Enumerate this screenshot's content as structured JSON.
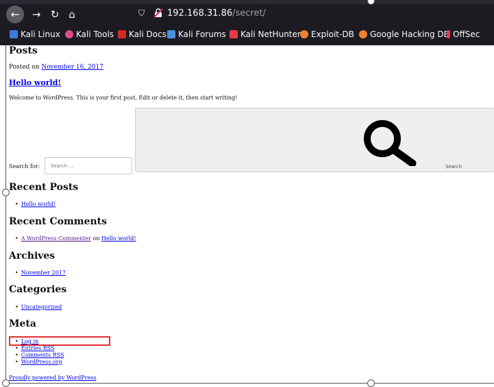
{
  "browser": {
    "url_host": "192.168.31.86",
    "url_path": "/secret/",
    "bookmarks": [
      {
        "label": "Kali Linux",
        "color": "#3a7bd5"
      },
      {
        "label": "Kali Tools",
        "color": "#e04a8c"
      },
      {
        "label": "Kali Docs",
        "color": "#d62828"
      },
      {
        "label": "Kali Forums",
        "color": "#4a90e2"
      },
      {
        "label": "Kali NetHunter",
        "color": "#e63946"
      },
      {
        "label": "Exploit-DB",
        "color": "#f07f2f"
      },
      {
        "label": "Google Hacking DB",
        "color": "#f07f2f"
      },
      {
        "label": "OffSec",
        "color": "#e63946"
      }
    ]
  },
  "page": {
    "heading": "Posts",
    "posted_prefix": "Posted on",
    "posted_date": "November 16, 2017",
    "post_title": "Hello world!",
    "post_body": "Welcome to WordPress. This is your first post. Edit or delete it, then start writing!",
    "search_label": "Search for:",
    "search_placeholder": "Search …",
    "search_button": "Search",
    "recent_posts_title": "Recent Posts",
    "recent_posts": [
      "Hello world!"
    ],
    "recent_comments_title": "Recent Comments",
    "comment_author": "A WordPress Commenter",
    "comment_on": "on",
    "comment_post": "Hello world!",
    "archives_title": "Archives",
    "archives": [
      "November 2017"
    ],
    "categories_title": "Categories",
    "categories": [
      "Uncategorized"
    ],
    "meta_title": "Meta",
    "meta": [
      "Log in",
      "Entries RSS",
      "Comments RSS",
      "WordPress.org"
    ],
    "footer": "Proudly powered by WordPress"
  },
  "colors": {
    "highlight": "#e03030",
    "link": "#0000ee",
    "visited": "#551a8b"
  }
}
